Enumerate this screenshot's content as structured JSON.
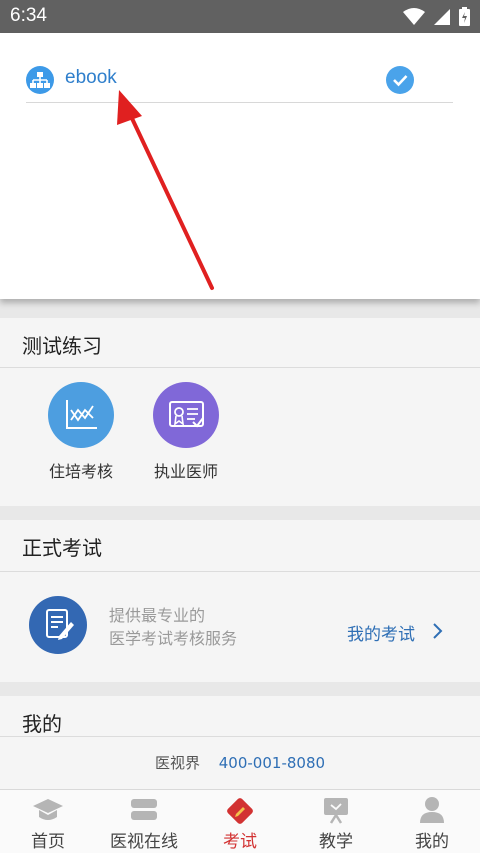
{
  "status_bar": {
    "time": "6:34"
  },
  "org_selector": {
    "item_name": "ebook",
    "selected": true
  },
  "practice": {
    "title": "测试练习",
    "items": [
      {
        "label": "住培考核",
        "icon": "chart-icon",
        "color": "#4d9ee0"
      },
      {
        "label": "执业医师",
        "icon": "certificate-icon",
        "color": "#8068d8"
      }
    ]
  },
  "formal_exam": {
    "title": "正式考试",
    "desc_line1": "提供最专业的",
    "desc_line2": "医学考试考核服务",
    "link_label": "我的考试"
  },
  "mine": {
    "title": "我的",
    "contact_name": "医视界",
    "contact_phone": "400-001-8080"
  },
  "bottom_nav": [
    {
      "label": "首页",
      "icon": "graduation-cap-icon",
      "active": false
    },
    {
      "label": "医视在线",
      "icon": "stack-icon",
      "active": false
    },
    {
      "label": "考试",
      "icon": "exam-icon",
      "active": true
    },
    {
      "label": "教学",
      "icon": "presentation-icon",
      "active": false
    },
    {
      "label": "我的",
      "icon": "user-icon",
      "active": false
    }
  ],
  "colors": {
    "accent": "#2f6fb5",
    "active_tab": "#d23232",
    "annotation_arrow": "#e02020"
  }
}
